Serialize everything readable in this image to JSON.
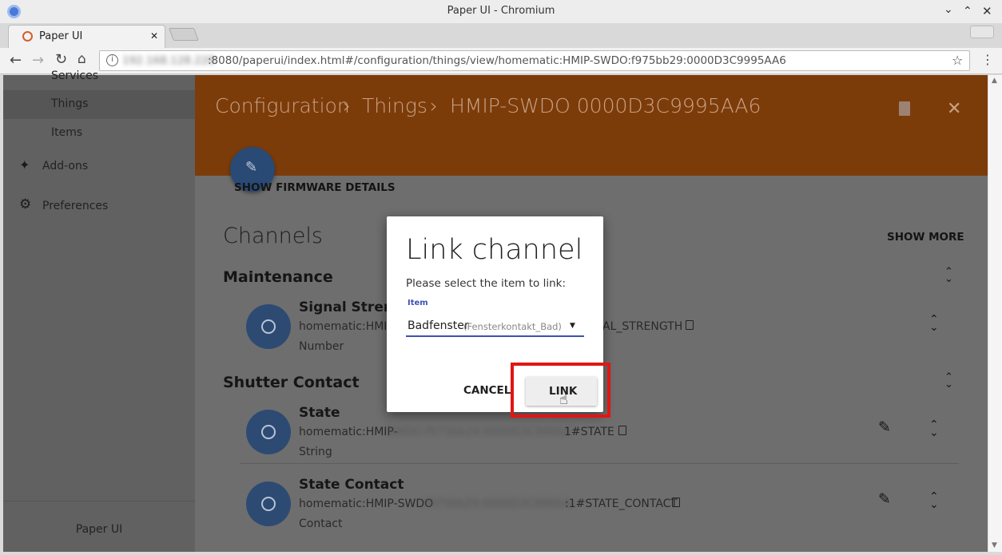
{
  "window": {
    "title": "Paper UI - Chromium"
  },
  "tab": {
    "title": "Paper UI"
  },
  "address": {
    "url_host": "192.168.128.228",
    "url_rest": ":8080/paperui/index.html#/configuration/things/view/homematic:HMIP-SWDO:f975bb29:0000D3C9995AA6"
  },
  "sidebar": {
    "items": [
      {
        "label": "Services"
      },
      {
        "label": "Things"
      },
      {
        "label": "Items"
      },
      {
        "label": "Add-ons"
      },
      {
        "label": "Preferences"
      }
    ],
    "footer": "Paper UI"
  },
  "header": {
    "crumb1": "Configuration",
    "crumb2": "Things",
    "crumb3": "HMIP-SWDO 0000D3C9995AA6",
    "sep": "›"
  },
  "main": {
    "firmware_link": "SHOW FIRMWARE DETAILS",
    "channels_title": "Channels",
    "show_more": "SHOW MORE",
    "sections": [
      {
        "title": "Maintenance",
        "channels": [
          {
            "title": "Signal Strength",
            "uid": "homematic:HMIP-SWDO:f975bb29:0000D3C9995AA6:0#SIGNAL_STRENGTH",
            "type": "Number"
          }
        ]
      },
      {
        "title": "Shutter Contact",
        "channels": [
          {
            "title": "State",
            "uid_prefix": "homematic:HMIP-",
            "uid_blur": "SWDO:f975bb29:0000D3C9995AA6:",
            "uid_suffix": "1#STATE",
            "type": "String"
          },
          {
            "title": "State Contact",
            "uid_prefix": "homematic:HMIP-SWDO",
            "uid_blur": ":f975bb29:0000D3C9995AA6",
            "uid_suffix": ":1#STATE_CONTACT",
            "type": "Contact"
          }
        ]
      }
    ],
    "signal_visible_prefix": "homematic:HMIP-",
    "signal_visible_suffix": "AL_STRENGTH"
  },
  "dialog": {
    "title": "Link channel",
    "prompt": "Please select the item to link:",
    "field_label": "Item",
    "selected_item": "Badfenster",
    "selected_item_name": "(Fensterkontakt_Bad)",
    "cancel_label": "CANCEL",
    "link_label": "LINK"
  },
  "colors": {
    "accent": "#f57c00",
    "dialog_accent": "#3f51b5",
    "highlight": "#e21515"
  }
}
